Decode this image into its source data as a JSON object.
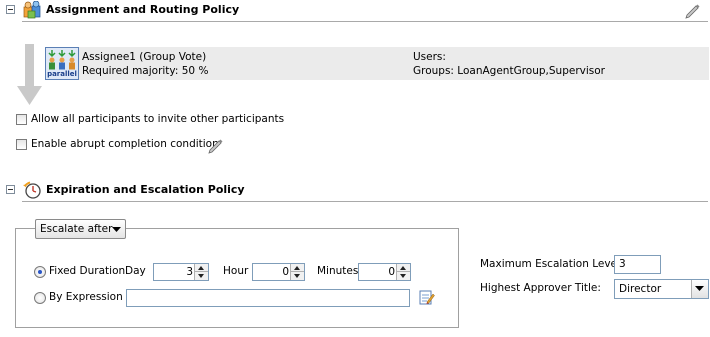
{
  "assignment": {
    "title": "Assignment and Routing Policy",
    "participant": {
      "name": "Assignee1 (Group Vote)",
      "majority": "Required majority: 50 %",
      "icon_label": "parallel",
      "users_label": "Users:",
      "groups_label": "Groups: LoanAgentGroup,Supervisor"
    },
    "allow_invite_label": "Allow all participants to invite other participants",
    "abrupt_completion_label": "Enable abrupt completion condition"
  },
  "expiration": {
    "title": "Expiration and Escalation Policy",
    "mode_button": "Escalate after",
    "fixed_duration_label": "Fixed Duration",
    "day_label": "Day",
    "day_value": "3",
    "hour_label": "Hour",
    "hour_value": "0",
    "minutes_label": "Minutes",
    "minutes_value": "0",
    "by_expression_label": "By Expression",
    "expression_value": "",
    "max_levels_label": "Maximum Escalation Levels",
    "max_levels_value": "3",
    "highest_approver_label": "Highest Approver Title:",
    "highest_approver_value": "Director"
  },
  "icons": [
    "collapse-icon",
    "assignment-icon",
    "edit-pencil-icon",
    "flow-arrow-icon",
    "parallel-group-icon",
    "expiration-clock-icon",
    "dropdown-arrow-icon",
    "expression-builder-icon"
  ],
  "colors": {
    "participant_row": "#ebebeb",
    "section_rule": "#a9a9a9",
    "input_border": "#7f9db9"
  }
}
